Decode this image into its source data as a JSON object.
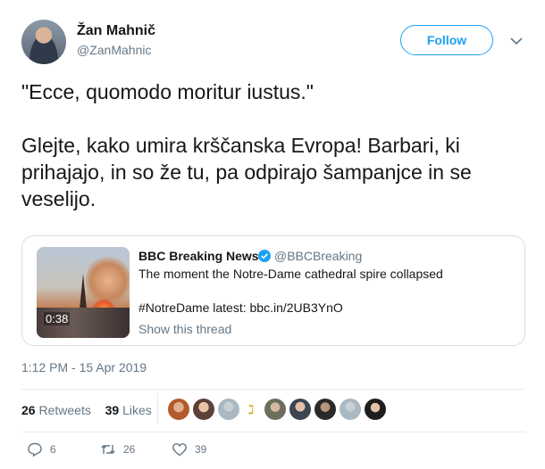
{
  "author": {
    "name": "Žan Mahnič",
    "handle": "@ZanMahnic",
    "follow_label": "Follow"
  },
  "tweet": {
    "line1": "\"Ecce, quomodo moritur iustus.\"",
    "line2": "Glejte, kako umira krščanska Evropa! Barbari, ki prihajajo, in so že tu, pa odpirajo šampanjce in se veselijo."
  },
  "quoted": {
    "name": "BBC Breaking News",
    "handle": "@BBCBreaking",
    "text1": "The moment the Notre-Dame cathedral spire collapsed",
    "text2": "#NotreDame latest: bbc.in/2UB3YnO",
    "show_thread": "Show this thread",
    "video_duration": "0:38"
  },
  "meta": {
    "timestamp": "1:12 PM - 15 Apr 2019"
  },
  "stats": {
    "retweets_count": "26",
    "retweets_label": "Retweets",
    "likes_count": "39",
    "likes_label": "Likes"
  },
  "actions": {
    "reply_count": "6",
    "retweet_count": "26",
    "like_count": "39"
  },
  "colors": {
    "accent": "#1da1f2",
    "muted": "#657786"
  }
}
